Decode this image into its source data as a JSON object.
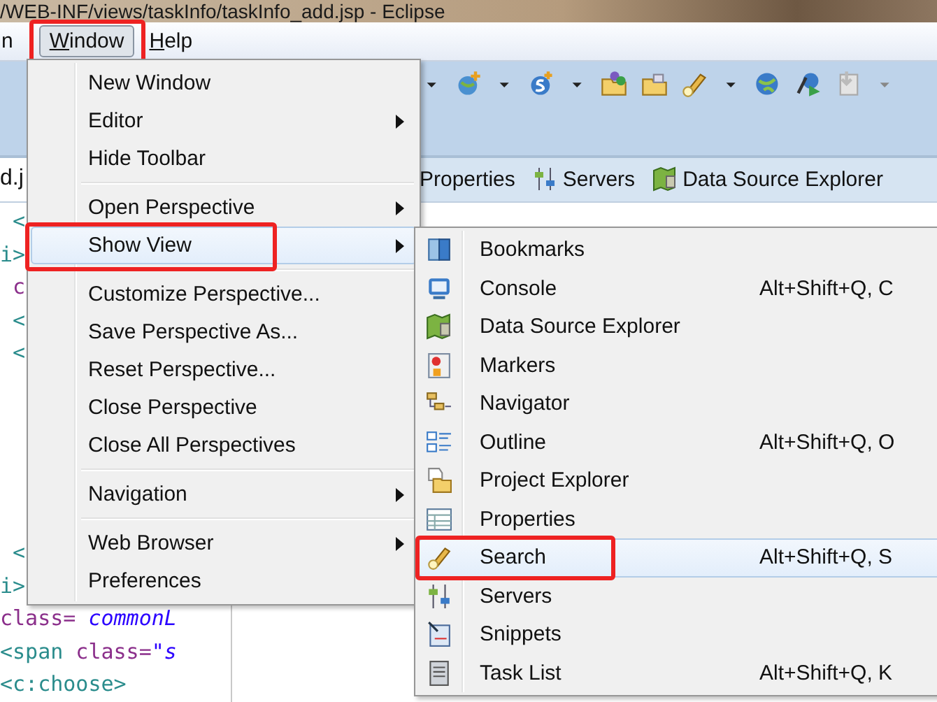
{
  "window": {
    "title": "/WEB-INF/views/taskInfo/taskInfo_add.jsp - Eclipse"
  },
  "menu_bar": [
    {
      "label": "n",
      "selected": false,
      "annotated": false,
      "mnemonic_underlined": false
    },
    {
      "label": "Window",
      "selected": true,
      "annotated": true,
      "mnemonic_underlined": true
    },
    {
      "label": "Help",
      "selected": false,
      "annotated": false,
      "mnemonic_underlined": true
    }
  ],
  "editor_tab": {
    "label": "d.j"
  },
  "view_tabs": [
    {
      "label": "Properties"
    },
    {
      "label": "Servers"
    },
    {
      "label": "Data Source Explorer"
    }
  ],
  "code_top": [
    [
      {
        "text": " <",
        "kind": "tag"
      }
    ],
    [
      {
        "text": "i>",
        "kind": "tag"
      }
    ],
    [
      {
        "text": " c",
        "kind": "attr"
      }
    ],
    [
      {
        "text": " <",
        "kind": "tag"
      }
    ],
    [
      {
        "text": " <",
        "kind": "tag"
      }
    ]
  ],
  "code_bottom": [
    [
      {
        "text": " <",
        "kind": "tag"
      }
    ],
    [
      {
        "text": "i>",
        "kind": "tag"
      }
    ],
    [
      {
        "text": "class=",
        "kind": "attr"
      },
      {
        "text": " commonL",
        "kind": "value"
      }
    ],
    [
      {
        "text": "<span",
        "kind": "tag"
      },
      {
        "text": " class=",
        "kind": "attr"
      },
      {
        "text": "\"s",
        "kind": "value"
      }
    ],
    [
      {
        "text": "<c:choose>",
        "kind": "tag"
      }
    ]
  ],
  "window_menu": [
    {
      "kind": "item",
      "label": "New Window",
      "selected": false,
      "annotated": false
    },
    {
      "kind": "submenu",
      "label": "Editor",
      "selected": false,
      "annotated": false
    },
    {
      "kind": "item",
      "label": "Hide Toolbar",
      "selected": false,
      "annotated": false
    },
    {
      "kind": "separator"
    },
    {
      "kind": "submenu",
      "label": "Open Perspective",
      "selected": false,
      "annotated": false
    },
    {
      "kind": "submenu",
      "label": "Show View",
      "selected": true,
      "annotated": true
    },
    {
      "kind": "separator"
    },
    {
      "kind": "item",
      "label": "Customize Perspective...",
      "selected": false,
      "annotated": false
    },
    {
      "kind": "item",
      "label": "Save Perspective As...",
      "selected": false,
      "annotated": false
    },
    {
      "kind": "item",
      "label": "Reset Perspective...",
      "selected": false,
      "annotated": false
    },
    {
      "kind": "item",
      "label": "Close Perspective",
      "selected": false,
      "annotated": false
    },
    {
      "kind": "item",
      "label": "Close All Perspectives",
      "selected": false,
      "annotated": false
    },
    {
      "kind": "separator"
    },
    {
      "kind": "submenu",
      "label": "Navigation",
      "selected": false,
      "annotated": false
    },
    {
      "kind": "separator"
    },
    {
      "kind": "submenu",
      "label": "Web Browser",
      "selected": false,
      "annotated": false
    },
    {
      "kind": "item",
      "label": "Preferences",
      "selected": false,
      "annotated": false
    }
  ],
  "show_view_menu": [
    {
      "label": "Bookmarks",
      "selected": false,
      "annotated": false
    },
    {
      "label": "Console",
      "shortcut": "Alt+Shift+Q, C",
      "selected": false,
      "annotated": false
    },
    {
      "label": "Data Source Explorer",
      "selected": false,
      "annotated": false
    },
    {
      "label": "Markers",
      "selected": false,
      "annotated": false
    },
    {
      "label": "Navigator",
      "selected": false,
      "annotated": false
    },
    {
      "label": "Outline",
      "shortcut": "Alt+Shift+Q, O",
      "selected": false,
      "annotated": false
    },
    {
      "label": "Project Explorer",
      "selected": false,
      "annotated": false
    },
    {
      "label": "Properties",
      "selected": false,
      "annotated": false
    },
    {
      "label": "Search",
      "shortcut": "Alt+Shift+Q, S",
      "selected": true,
      "annotated": true
    },
    {
      "label": "Servers",
      "selected": false,
      "annotated": false
    },
    {
      "label": "Snippets",
      "selected": false,
      "annotated": false
    },
    {
      "label": "Task List",
      "shortcut": "Alt+Shift+Q, K",
      "selected": false,
      "annotated": false
    }
  ]
}
